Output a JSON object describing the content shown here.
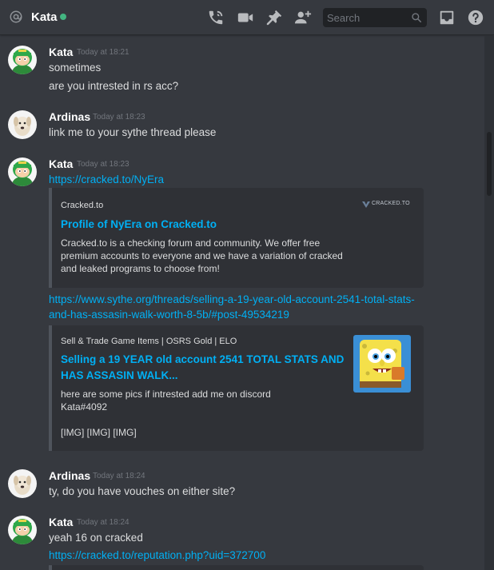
{
  "header": {
    "channel_name": "Kata",
    "status": "online",
    "search_placeholder": "Search",
    "icons": [
      "call-icon",
      "video-icon",
      "pin-icon",
      "add-friend-icon",
      "inbox-icon",
      "help-icon"
    ]
  },
  "messages": [
    {
      "author": "Kata",
      "time": "Today at 18:21",
      "lines": [
        "sometimes",
        "are you intrested in rs acc?"
      ]
    },
    {
      "author": "Ardinas",
      "time": "Today at 18:23",
      "lines": [
        "link me to your sythe thread please"
      ]
    },
    {
      "author": "Kata",
      "time": "Today at 18:23",
      "link1": "https://cracked.to/NyEra",
      "embed1": {
        "provider": "Cracked.to",
        "logo_text": "CRACKED.TO",
        "title": "Profile of NyEra on Cracked.to",
        "desc": [
          "Cracked.to is a checking forum and community. We offer free",
          "premium accounts to everyone and we have a variation of cracked",
          "and leaked programs to choose from!"
        ]
      },
      "link2": [
        "https://www.sythe.org/threads/selling-a-19-year-old-account-2541-total-stats-",
        "and-has-assasin-walk-worth-8-5b/#post-49534219"
      ],
      "embed2": {
        "provider": "Sell & Trade Game Items | OSRS Gold | ELO",
        "title": [
          "Selling a 19 YEAR old account 2541 TOTAL STATS AND",
          "HAS ASSASIN WALK..."
        ],
        "desc": [
          "here are some pics if intrested add me on discord",
          "Kata#4092",
          "",
          "[IMG] [IMG] [IMG]"
        ]
      }
    },
    {
      "author": "Ardinas",
      "time": "Today at 18:24",
      "lines": [
        "ty, do you have vouches on either site?"
      ]
    },
    {
      "author": "Kata",
      "time": "Today at 18:24",
      "lines": [
        "yeah 16 on cracked"
      ],
      "link": "https://cracked.to/reputation.php?uid=372700"
    }
  ],
  "colors": {
    "background": "#36393f",
    "embed_bg": "#2f3136",
    "link": "#00b0f4",
    "online": "#43b581"
  }
}
